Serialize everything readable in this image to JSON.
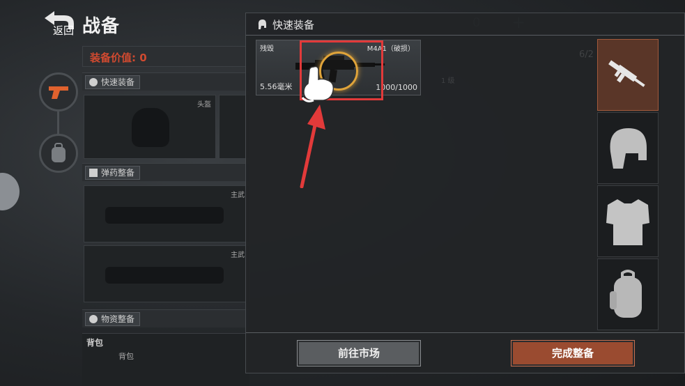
{
  "page": {
    "back_label": "返回",
    "title": "战备"
  },
  "background": {
    "value_label": "装备价值: 0",
    "quick_equip_tag": "快速装备",
    "helmet_slot_label": "头盔",
    "ammo_tag": "弹药整备",
    "primary_slot_label": "主武",
    "supplies_tag": "物资整备",
    "backpack_section": "背包",
    "backpack_slot_label": "背包",
    "counter_value": "0",
    "counter_plus": "+",
    "faint_a": "1 级",
    "faint_b": "6/2"
  },
  "modal": {
    "title": "快速装备",
    "item": {
      "state": "残毁",
      "name": "M4A1（破损）",
      "ammo": "5.56毫米",
      "durability": "1000/1000"
    },
    "categories": [
      {
        "name": "weapon",
        "icon": "rifle-icon",
        "active": true
      },
      {
        "name": "helmet",
        "icon": "helmet-icon",
        "active": false
      },
      {
        "name": "armor",
        "icon": "armor-vest-icon",
        "active": false
      },
      {
        "name": "backpack",
        "icon": "backpack-icon",
        "active": false
      }
    ],
    "buttons": {
      "market": "前往市场",
      "done": "完成整备"
    }
  },
  "colors": {
    "accent": "#9a4b30",
    "value_red": "#d04a30",
    "highlight_red": "#e23a3a",
    "ring_gold": "#e0a43a"
  }
}
